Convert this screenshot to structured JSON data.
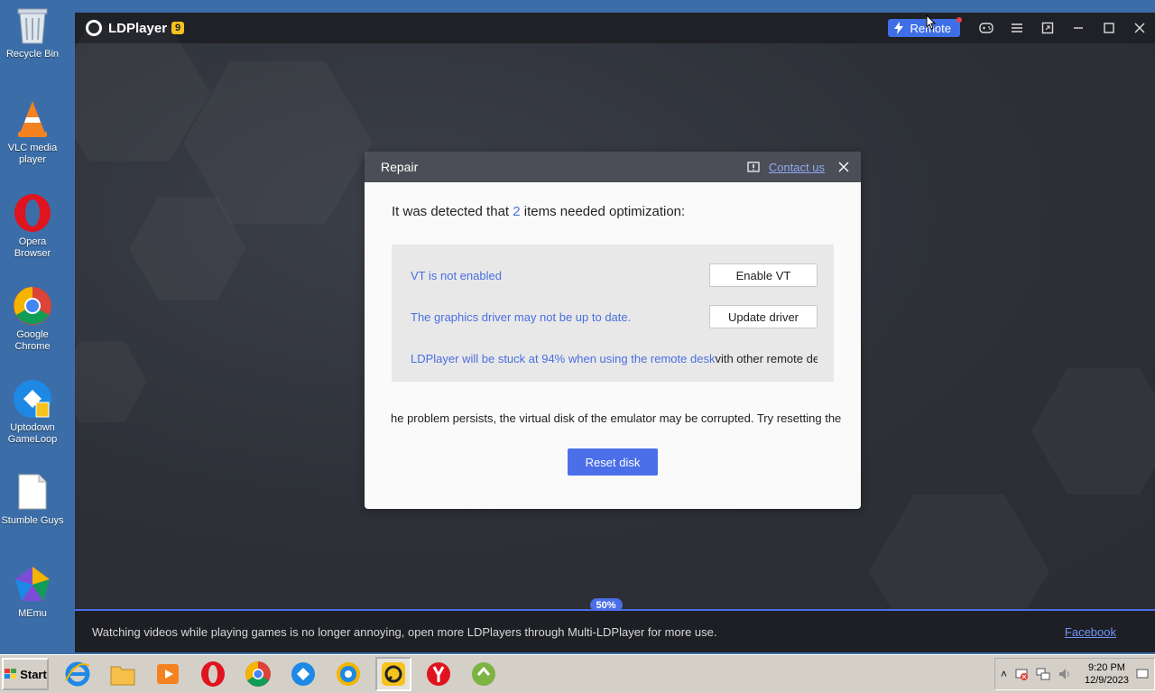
{
  "desktop": {
    "icons": [
      {
        "label": "Recycle Bin",
        "icon": "recycle-bin-icon"
      },
      {
        "label": "VLC media player",
        "icon": "vlc-icon"
      },
      {
        "label": "Opera Browser",
        "icon": "opera-icon"
      },
      {
        "label": "Google Chrome",
        "icon": "chrome-icon"
      },
      {
        "label": "Uptodown GameLoop",
        "icon": "gameloop-icon"
      },
      {
        "label": "Stumble Guys",
        "icon": "file-icon"
      },
      {
        "label": "MEmu",
        "icon": "memu-icon"
      }
    ]
  },
  "ldplayer": {
    "title": "LDPlayer",
    "version": "9",
    "remote_label": "Remote",
    "progress_label": "50%",
    "progress_value": 0.5,
    "tip_text": "Watching videos while playing games is no longer annoying, open more LDPlayers through Multi-LDPlayer for more use.",
    "facebook_label": "Facebook"
  },
  "dialog": {
    "title": "Repair",
    "contact_label": "Contact us",
    "detected_prefix": "It was detected that ",
    "detected_count": "2",
    "detected_suffix": " items needed optimization:",
    "vt_text": "VT is not enabled",
    "vt_button": "Enable VT",
    "driver_text": "The graphics driver may not be up to date.",
    "driver_button": "Update driver",
    "remote_warning_a": "LDPlayer will be stuck at 94% when using the remote desk",
    "remote_warning_b": "vith other remote desl",
    "persist_text": "he problem persists, the virtual disk of the emulator may be corrupted. Try resetting the di",
    "reset_button": "Reset disk"
  },
  "taskbar": {
    "start_label": "Start",
    "clock_time": "9:20 PM",
    "clock_date": "12/9/2023"
  },
  "colors": {
    "accent": "#4a6fe8",
    "desktop_bg": "#3b6ea8",
    "window_bg": "#2e3138"
  }
}
